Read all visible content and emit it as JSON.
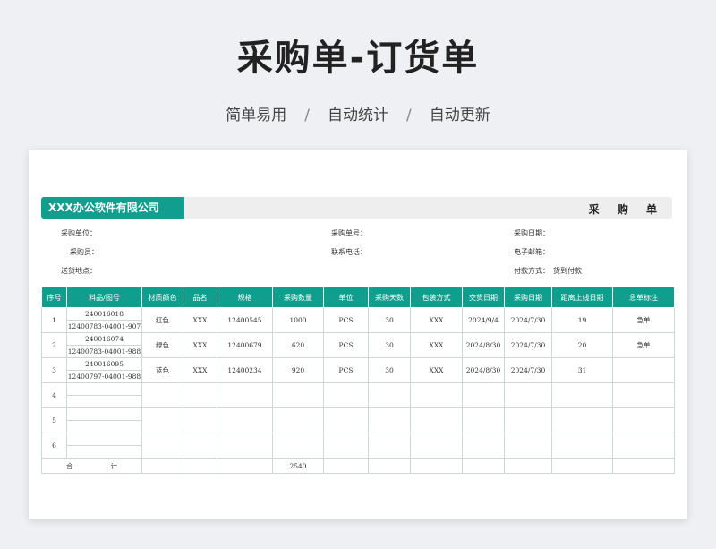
{
  "hero": {
    "title": "采购单-订货单",
    "tags": [
      "简单易用",
      "自动统计",
      "自动更新"
    ],
    "separator": "/"
  },
  "sheet": {
    "company": "XXX办公软件有限公司",
    "doc_type": "采 购 单",
    "fields": {
      "purchase_unit": {
        "label": "采购单位：",
        "value": ""
      },
      "purchase_no": {
        "label": "采购单号：",
        "value": ""
      },
      "purchase_date": {
        "label": "采购日期：",
        "value": ""
      },
      "buyer": {
        "label": "采购员：",
        "value": ""
      },
      "phone": {
        "label": "联系电话：",
        "value": ""
      },
      "email": {
        "label": "电子邮箱：",
        "value": ""
      },
      "delivery_place": {
        "label": "送货地点：",
        "value": ""
      },
      "payment": {
        "label": "付款方式：",
        "value": "货到付款"
      }
    },
    "columns": [
      "序号",
      "料品/图号",
      "材质颜色",
      "品名",
      "规格",
      "采购数量",
      "单位",
      "采购天数",
      "包装方式",
      "交货日期",
      "采购日期",
      "距离上线日期",
      "急单标注"
    ],
    "rows": [
      {
        "no": "1",
        "item_no": "240016018",
        "drawing_no": "12400783-04001-907",
        "color": "红色",
        "name": "XXX",
        "spec": "12400545",
        "qty": "1000",
        "unit": "PCS",
        "days": "30",
        "pack": "XXX",
        "delivery": "2024/9/4",
        "purchase": "2024/7/30",
        "until": "19",
        "urgent": "急单"
      },
      {
        "no": "2",
        "item_no": "240016074",
        "drawing_no": "12400783-04001-988",
        "color": "绿色",
        "name": "XXX",
        "spec": "12400679",
        "qty": "620",
        "unit": "PCS",
        "days": "30",
        "pack": "XXX",
        "delivery": "2024/8/30",
        "purchase": "2024/7/30",
        "until": "20",
        "urgent": "急单"
      },
      {
        "no": "3",
        "item_no": "240016095",
        "drawing_no": "12400797-04001-988",
        "color": "蓝色",
        "name": "XXX",
        "spec": "12400234",
        "qty": "920",
        "unit": "PCS",
        "days": "30",
        "pack": "XXX",
        "delivery": "2024/8/30",
        "purchase": "2024/7/30",
        "until": "31",
        "urgent": ""
      },
      {
        "no": "4",
        "item_no": "",
        "drawing_no": "",
        "color": "",
        "name": "",
        "spec": "",
        "qty": "",
        "unit": "",
        "days": "",
        "pack": "",
        "delivery": "",
        "purchase": "",
        "until": "",
        "urgent": ""
      },
      {
        "no": "5",
        "item_no": "",
        "drawing_no": "",
        "color": "",
        "name": "",
        "spec": "",
        "qty": "",
        "unit": "",
        "days": "",
        "pack": "",
        "delivery": "",
        "purchase": "",
        "until": "",
        "urgent": ""
      },
      {
        "no": "6",
        "item_no": "",
        "drawing_no": "",
        "color": "",
        "name": "",
        "spec": "",
        "qty": "",
        "unit": "",
        "days": "",
        "pack": "",
        "delivery": "",
        "purchase": "",
        "until": "",
        "urgent": ""
      }
    ],
    "total": {
      "label_a": "合",
      "label_b": "计",
      "qty": "2540"
    },
    "colors": {
      "accent": "#129e8f",
      "strip": "#eeeeee"
    }
  }
}
